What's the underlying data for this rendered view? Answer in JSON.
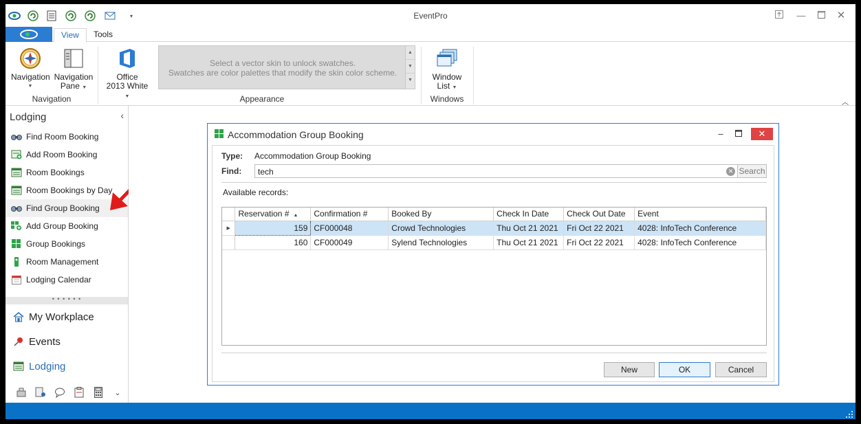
{
  "app": {
    "title": "EventPro"
  },
  "ribbon": {
    "tabs": [
      "View",
      "Tools"
    ],
    "active_tab": "View",
    "buttons": {
      "navigation": "Navigation",
      "navigation_pane_1": "Navigation",
      "navigation_pane_2": "Pane",
      "office_1": "Office",
      "office_2": "2013 White",
      "window_list_1": "Window",
      "window_list_2": "List"
    },
    "swatch_message_1": "Select a vector skin to unlock swatches.",
    "swatch_message_2": "Swatches are color palettes that modify the skin color scheme.",
    "groups": [
      "Navigation",
      "Appearance",
      "Windows"
    ]
  },
  "nav": {
    "title": "Lodging",
    "items": [
      {
        "label": "Find Room Booking",
        "icon": "binoculars-icon"
      },
      {
        "label": "Add Room Booking",
        "icon": "add-room-icon"
      },
      {
        "label": "Room Bookings",
        "icon": "room-bookings-icon"
      },
      {
        "label": "Room Bookings by Day",
        "icon": "room-bookings-day-icon"
      },
      {
        "label": "Find Group Booking",
        "icon": "binoculars-icon"
      },
      {
        "label": "Add Group Booking",
        "icon": "add-group-icon"
      },
      {
        "label": "Group Bookings",
        "icon": "group-bookings-icon"
      },
      {
        "label": "Room Management",
        "icon": "room-management-icon"
      },
      {
        "label": "Lodging Calendar",
        "icon": "calendar-icon"
      }
    ],
    "splitter": "• • • • • •",
    "modules": [
      {
        "label": "My Workplace",
        "icon": "workplace-icon"
      },
      {
        "label": "Events",
        "icon": "pushpin-icon"
      },
      {
        "label": "Lodging",
        "icon": "lodging-icon"
      }
    ],
    "active_module": "Lodging"
  },
  "dialog": {
    "title": "Accommodation Group Booking",
    "type_label": "Type:",
    "type_value": "Accommodation Group Booking",
    "find_label": "Find:",
    "find_value": "tech",
    "search_button": "Search",
    "available_label": "Available records:",
    "columns": [
      "Reservation #",
      "Confirmation #",
      "Booked By",
      "Check In Date",
      "Check Out Date",
      "Event"
    ],
    "rows": [
      {
        "reservation": "159",
        "confirmation": "CF000048",
        "booked_by": "Crowd Technologies",
        "check_in": "Thu Oct 21 2021",
        "check_out": "Fri Oct 22 2021",
        "event": "4028: InfoTech Conference"
      },
      {
        "reservation": "160",
        "confirmation": "CF000049",
        "booked_by": "Sylend Technologies",
        "check_in": "Thu Oct 21 2021",
        "check_out": "Fri Oct 22 2021",
        "event": "4028: InfoTech Conference"
      }
    ],
    "buttons": {
      "new": "New",
      "ok": "OK",
      "cancel": "Cancel"
    }
  },
  "colors": {
    "accent": "#2b7cd3",
    "status_bar": "#0a72c6",
    "selection": "#cde4f7",
    "close_button": "#e04343",
    "annotation_arrow": "#e01b1b"
  }
}
